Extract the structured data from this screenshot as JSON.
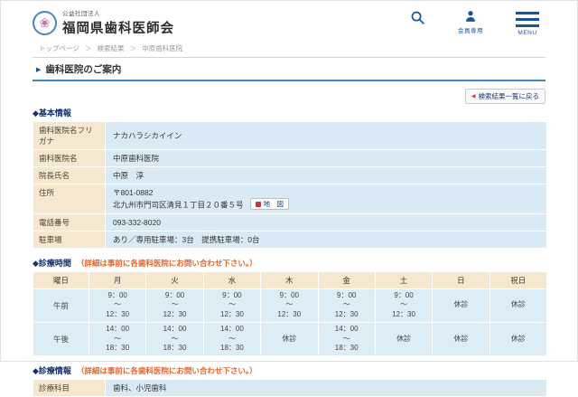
{
  "header": {
    "org_type": "公益社団法人",
    "org_name": "福岡県歯科医師会",
    "member_label": "会員専用",
    "menu_label": "MENU"
  },
  "breadcrumb": {
    "separator": "＞",
    "items": [
      "トップページ",
      "検索結果",
      "中原歯科医院"
    ]
  },
  "page": {
    "title": "歯科医院のご案内",
    "back_button_label": "検索結果一覧に戻る"
  },
  "basic_info": {
    "heading": "◆基本情報",
    "rows": [
      {
        "label": "歯科医院名フリガナ",
        "value": "ナカハラシカイイン"
      },
      {
        "label": "歯科医院名",
        "value": "中原歯科医院"
      },
      {
        "label": "院長氏名",
        "value": "中原　淳"
      },
      {
        "label": "住所",
        "value": "〒801-0882\n北九州市門司区清見１丁目２０番５号",
        "map_label": "地　図"
      },
      {
        "label": "電話番号",
        "value": "093-332-8020"
      },
      {
        "label": "駐車場",
        "value": "あり／専用駐車場：3台　提携駐車場：0台"
      }
    ]
  },
  "hours": {
    "heading": "◆診療時間",
    "note": "（詳細は事前に各歯科医院にお問い合わせ下さい。）",
    "columns": [
      "曜日",
      "月",
      "火",
      "水",
      "木",
      "金",
      "土",
      "日",
      "祝日"
    ],
    "rows": [
      {
        "label": "午前",
        "cells": [
          "9：00\n～\n12：30",
          "9：00\n～\n12：30",
          "9：00\n～\n12：30",
          "9：00\n～\n12：30",
          "9：00\n～\n12：30",
          "9：00\n～\n12：30",
          "休診",
          "休診"
        ]
      },
      {
        "label": "午後",
        "cells": [
          "14：00\n～\n18：30",
          "14：00\n～\n18：30",
          "14：00\n～\n18：30",
          "休診",
          "14：00\n～\n18：30",
          "休診",
          "休診",
          "休診"
        ]
      }
    ]
  },
  "treatment": {
    "heading": "◆診療情報",
    "note": "（詳細は事前に各歯科医院にお問い合わせ下さい。）",
    "rows": [
      {
        "label": "診療科目",
        "value": "歯科、小児歯科"
      }
    ]
  },
  "colors": {
    "accent_navy": "#17559c",
    "heading_navy": "#15306e",
    "note_orange": "#e2662c",
    "closed_red": "#e04848",
    "label_beige": "#f5e8cf",
    "value_blue": "#d9eaf4",
    "title_underline": "#4285b8"
  }
}
